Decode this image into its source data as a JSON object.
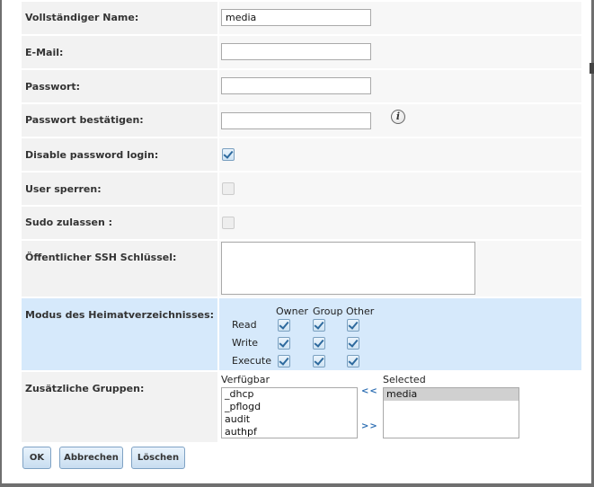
{
  "form": {
    "full_name": {
      "label": "Vollständiger Name:",
      "value": "media"
    },
    "email": {
      "label": "E-Mail:",
      "value": ""
    },
    "password": {
      "label": "Passwort:",
      "value": ""
    },
    "password_confirm": {
      "label": "Passwort bestätigen:",
      "value": ""
    },
    "disable_password_login": {
      "label": "Disable password login:",
      "checked": true
    },
    "lock_user": {
      "label": "User sperren:",
      "checked": false
    },
    "allow_sudo": {
      "label": "Sudo zulassen :",
      "checked": false
    },
    "ssh_key": {
      "label": "Öffentlicher SSH Schlüssel:",
      "value": ""
    },
    "home_mode": {
      "label": "Modus des Heimatverzeichnisses:",
      "columns": [
        "Owner",
        "Group",
        "Other"
      ],
      "rows": [
        {
          "label": "Read",
          "values": [
            true,
            true,
            true
          ]
        },
        {
          "label": "Write",
          "values": [
            true,
            true,
            true
          ]
        },
        {
          "label": "Execute",
          "values": [
            true,
            true,
            true
          ]
        }
      ]
    },
    "groups": {
      "label": "Zusätzliche Gruppen:",
      "available_caption": "Verfügbar",
      "selected_caption": "Selected",
      "available": [
        "_dhcp",
        "_pflogd",
        "audit",
        "authpf"
      ],
      "selected": [
        "media"
      ],
      "add_label": ">>",
      "remove_label": "<<"
    }
  },
  "buttons": {
    "ok": "OK",
    "cancel": "Abbrechen",
    "delete": "Löschen"
  },
  "icons": {
    "info": "info-icon"
  },
  "colors": {
    "permission_row_bg": "#d6e9fb",
    "label_bg": "#f2f2f2",
    "button_border": "#7fa2c4"
  }
}
